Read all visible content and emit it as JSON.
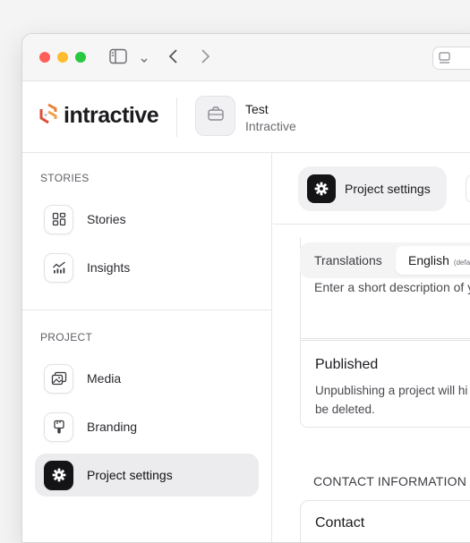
{
  "header": {
    "logo_text": "intractive",
    "project_name": "Test",
    "project_org": "Intractive"
  },
  "sidebar": {
    "stories_section": "STORIES",
    "project_section": "PROJECT",
    "items": [
      {
        "label": "Stories",
        "icon": "grid-icon"
      },
      {
        "label": "Insights",
        "icon": "chart-icon"
      },
      {
        "label": "Media",
        "icon": "images-icon"
      },
      {
        "label": "Branding",
        "icon": "brush-icon"
      },
      {
        "label": "Project settings",
        "icon": "gear-icon",
        "active": true
      }
    ]
  },
  "main": {
    "active_pill": "Project settings",
    "tabs": {
      "translations": "Translations",
      "english": "English",
      "english_suffix": "(defau"
    },
    "description_placeholder": "Enter a short description of y",
    "published": {
      "title": "Published",
      "text_line1": "Unpublishing a project will hi",
      "text_line2": "be deleted."
    },
    "contact_section": "CONTACT INFORMATION",
    "contact_title": "Contact"
  },
  "colors": {
    "accent_dark": "#141416",
    "logo_orange": "#e8833a",
    "logo_red": "#e04e39"
  }
}
